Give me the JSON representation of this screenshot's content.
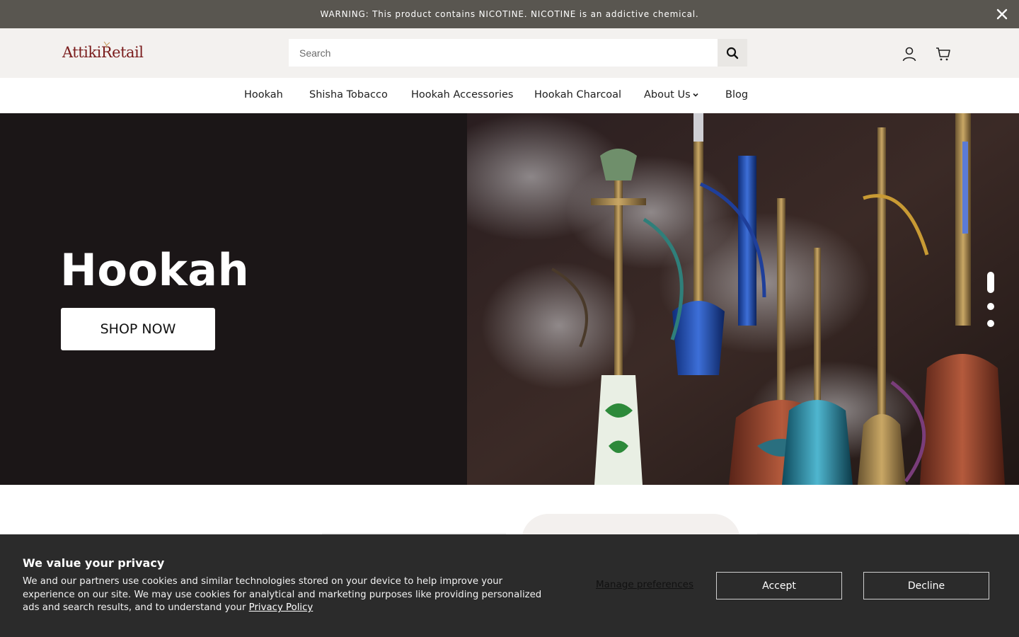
{
  "warning": {
    "text": "WARNING: This product contains NICOTINE. NICOTINE is an addictive chemical.",
    "close_icon": "close-icon"
  },
  "header": {
    "logo_text": "AttikiRetail",
    "search": {
      "placeholder": "Search",
      "value": "",
      "icon": "search-icon"
    },
    "icons": [
      "account-icon",
      "cart-icon"
    ]
  },
  "nav": {
    "items": [
      {
        "label": "Hookah"
      },
      {
        "label": "Shisha Tobacco"
      },
      {
        "label": "Hookah Accessories"
      },
      {
        "label": "Hookah Charcoal"
      },
      {
        "label": "About Us",
        "dropdown": true
      },
      {
        "label": "Blog"
      }
    ]
  },
  "hero": {
    "title": "Hookah",
    "cta": "SHOP NOW",
    "slides": 3,
    "active_slide": 1
  },
  "cookie": {
    "title": "We value your privacy",
    "text": "We and our partners use cookies and similar technologies stored on your device to help improve your experience on our site. We may use cookies for analytical and marketing purposes like providing personalized ads and search results, and to understand your",
    "privacy_link": "Privacy Policy",
    "manage": "Manage preferences",
    "accept": "Accept",
    "decline": "Decline"
  },
  "colors": {
    "warning_bg": "#595650",
    "header_bg": "#f3f1ef",
    "hero_bg": "#1b1617",
    "cookie_bg": "#2b2b2b",
    "logo": "#7a1c1c"
  }
}
